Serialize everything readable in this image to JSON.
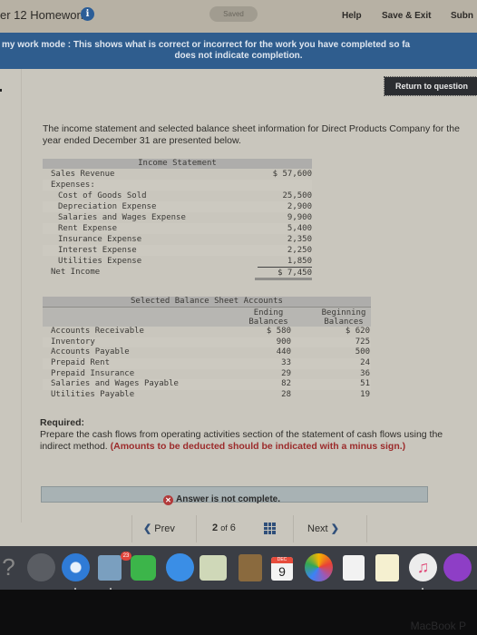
{
  "topbar": {
    "title": "er 12 Homework",
    "status": "Saved",
    "help": "Help",
    "save_exit": "Save & Exit",
    "submit": "Subn"
  },
  "banner": {
    "line1": "my work mode : This shows what is correct or incorrect for the work you have completed so fa",
    "line2": "does not indicate completion."
  },
  "return_button": "Return to question",
  "intro": "The income statement and selected balance sheet information for Direct Products Company for the year ended December 31 are presented below.",
  "income_statement": {
    "title": "Income Statement",
    "rows": [
      {
        "label": "Sales Revenue",
        "value": "$ 57,600",
        "indent": false
      },
      {
        "label": "Expenses:",
        "value": "",
        "indent": false
      },
      {
        "label": "Cost of Goods Sold",
        "value": "25,500",
        "indent": true
      },
      {
        "label": "Depreciation Expense",
        "value": "2,900",
        "indent": true
      },
      {
        "label": "Salaries and Wages Expense",
        "value": "9,900",
        "indent": true
      },
      {
        "label": "Rent Expense",
        "value": "5,400",
        "indent": true
      },
      {
        "label": "Insurance Expense",
        "value": "2,350",
        "indent": true
      },
      {
        "label": "Interest Expense",
        "value": "2,250",
        "indent": true
      },
      {
        "label": "Utilities Expense",
        "value": "1,850",
        "indent": true
      }
    ],
    "net_income_label": "Net Income",
    "net_income_value": "$ 7,450"
  },
  "balance_sheet": {
    "title": "Selected Balance Sheet Accounts",
    "col_ending": [
      "Ending",
      "Balances"
    ],
    "col_beginning": [
      "Beginning",
      "Balances"
    ],
    "rows": [
      {
        "label": "Accounts Receivable",
        "ending": "$ 580",
        "beginning": "$ 620"
      },
      {
        "label": "Inventory",
        "ending": "900",
        "beginning": "725"
      },
      {
        "label": "Accounts Payable",
        "ending": "440",
        "beginning": "500"
      },
      {
        "label": "Prepaid Rent",
        "ending": "33",
        "beginning": "24"
      },
      {
        "label": "Prepaid Insurance",
        "ending": "29",
        "beginning": "36"
      },
      {
        "label": "Salaries and Wages Payable",
        "ending": "82",
        "beginning": "51"
      },
      {
        "label": "Utilities Payable",
        "ending": "28",
        "beginning": "19"
      }
    ]
  },
  "required": {
    "heading": "Required:",
    "text": "Prepare the cash flows from operating activities section of the statement of cash flows using the indirect method.",
    "note": "(Amounts to be deducted should be indicated with a minus sign.)"
  },
  "answer_status": "Answer is not complete.",
  "pager": {
    "prev": "Prev",
    "current": "2",
    "of": "of",
    "total": "6",
    "next": "Next"
  },
  "dock": {
    "badge": "23",
    "calendar_month": "DEC",
    "calendar_day": "9",
    "items": [
      "help",
      "launchpad",
      "safari",
      "preview",
      "facetime",
      "messages",
      "maps",
      "contacts",
      "calendar",
      "photos",
      "reminders",
      "notes",
      "music",
      "podcasts"
    ]
  },
  "bezel_label": "MacBook P"
}
